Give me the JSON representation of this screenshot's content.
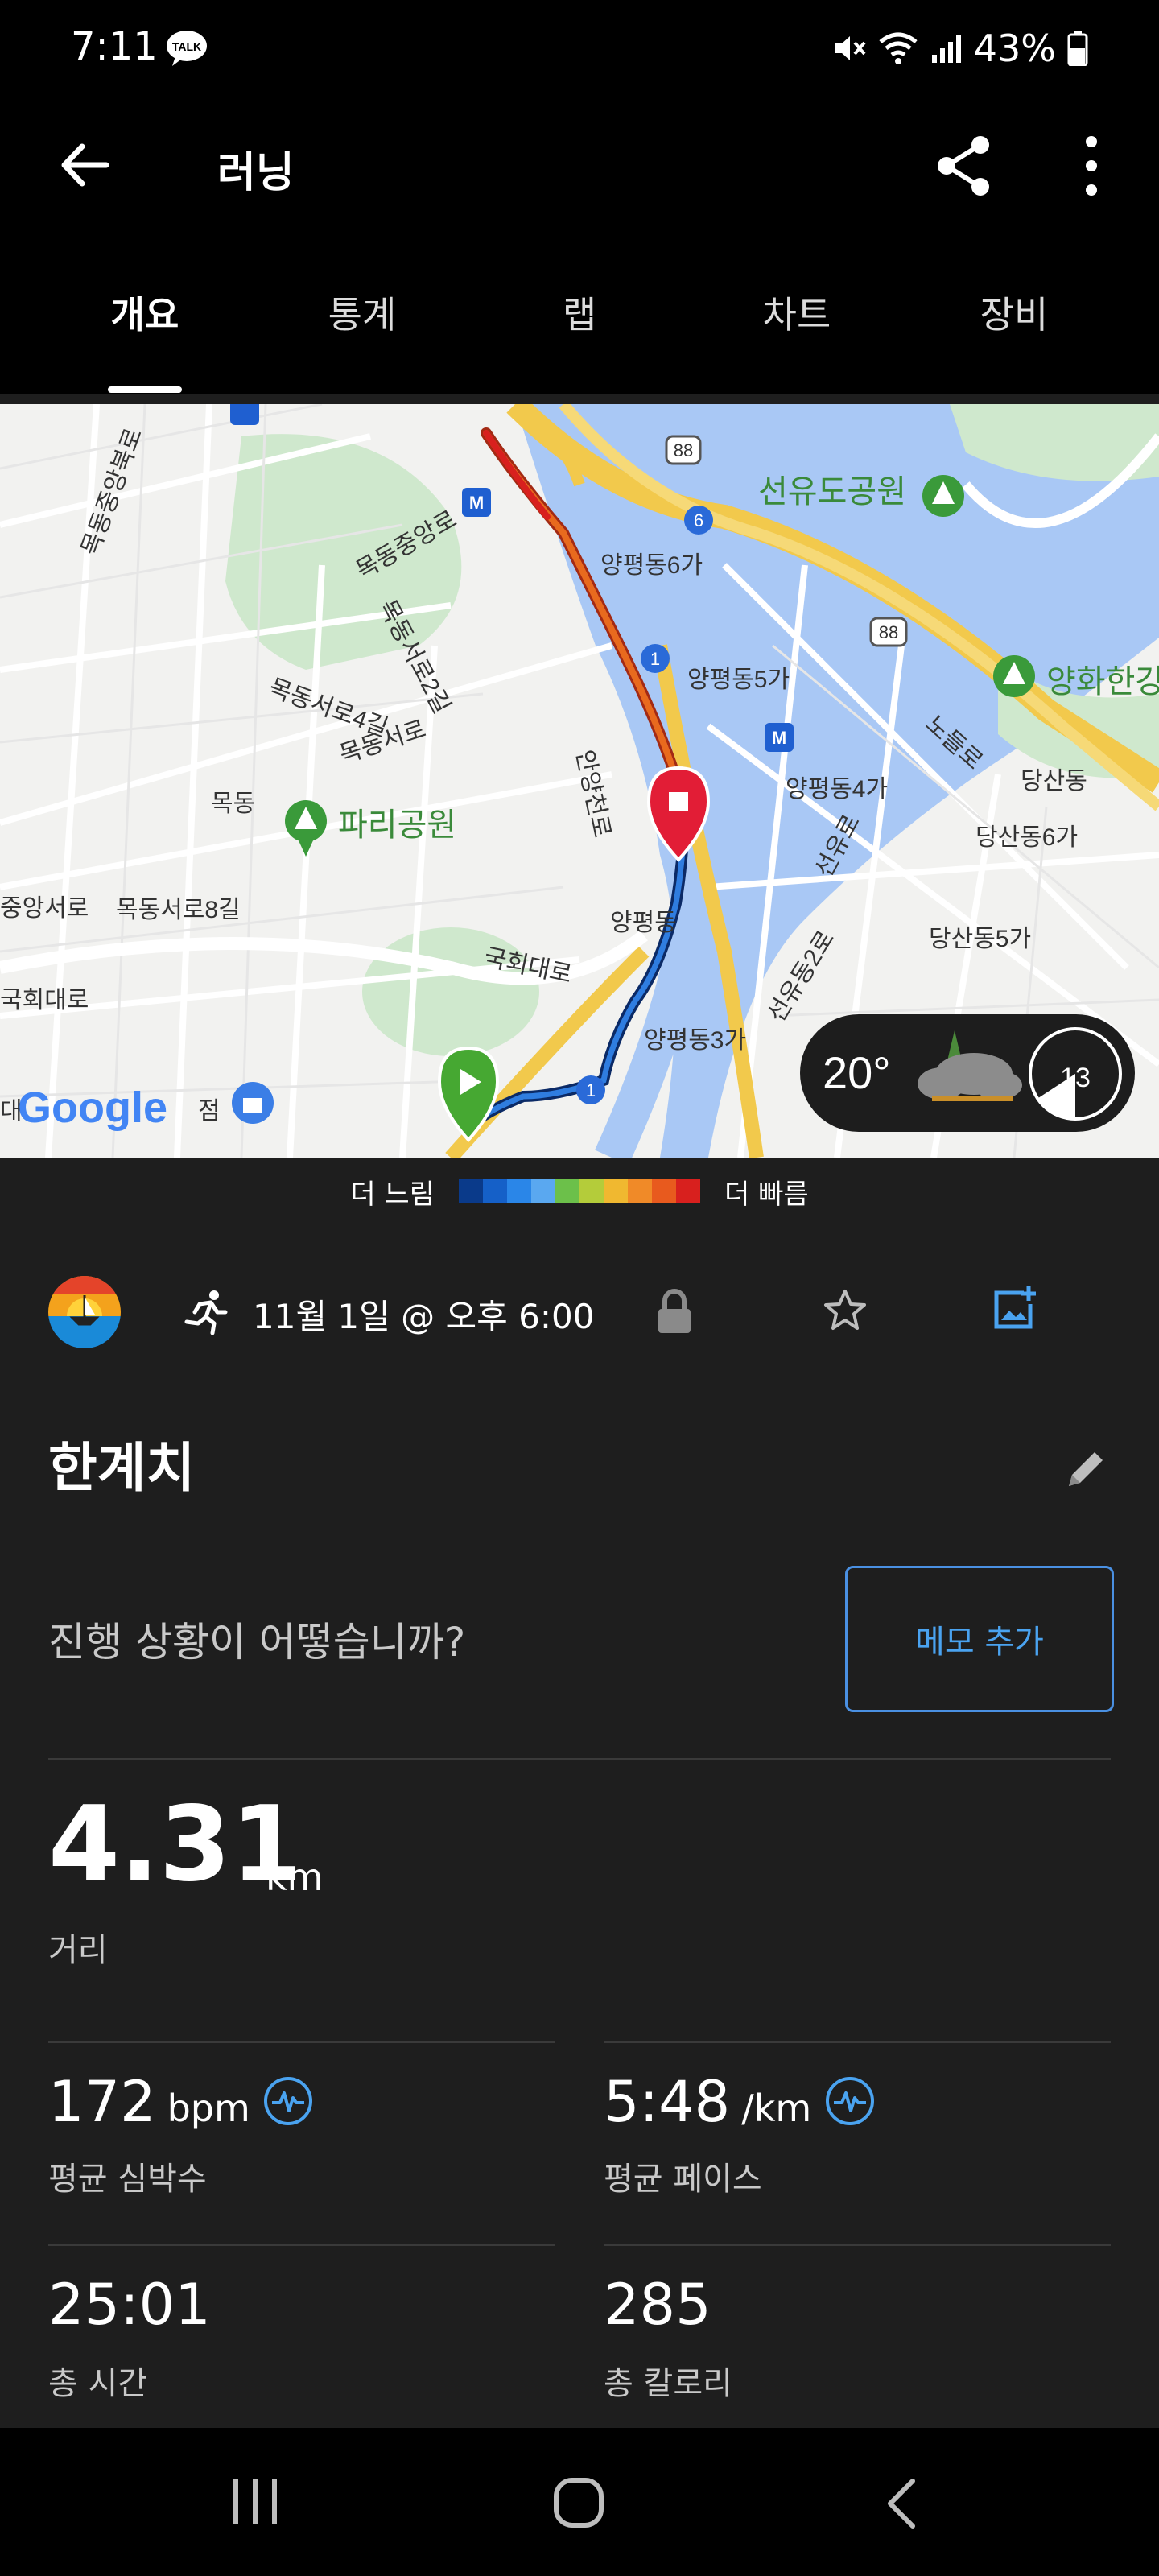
{
  "status_bar": {
    "time": "7:11",
    "talk_badge": "TALK",
    "battery_pct": "43%"
  },
  "header": {
    "title": "러닝"
  },
  "tabs": [
    {
      "label": "개요",
      "active": true
    },
    {
      "label": "통계"
    },
    {
      "label": "랩"
    },
    {
      "label": "차트"
    },
    {
      "label": "장비"
    }
  ],
  "map": {
    "labels": {
      "seonyudo_park": "선유도공원",
      "yanghwa": "양화한강",
      "paris_park": "파리공원",
      "yp6": "양평동6가",
      "yp5": "양평동5가",
      "yp4": "양평동4가",
      "yp3": "양평동3가",
      "yp": "양평동",
      "dangsan": "당산동",
      "dangsan6": "당산동6가",
      "dangsan5": "당산동5가",
      "mokdong": "목동",
      "mokdongseoro": "목동서로",
      "mokdongseoro4": "목동서로4길",
      "mokdongseoro2": "목동서로2길",
      "mokdongseoro8": "목동서로8길",
      "mokdongjungangro": "목동중앙로",
      "mokdongjungangbukro": "목동중앙북로",
      "jungangseoro": "중앙서로",
      "gukhoedaero": "국회대로",
      "gukhoedaero2": "국회대로",
      "anyangcheonro": "안양천로",
      "seonyuro": "선유로",
      "seonyudongro": "선유동2로",
      "nodeulro": "노들로",
      "route88a": "88",
      "route88b": "88",
      "route1a": "1",
      "route1b": "1",
      "route6": "6",
      "metro": "M",
      "google": "Google",
      "store": "점",
      "da": "대"
    },
    "weather": {
      "temperature": "20°",
      "moon": "13"
    }
  },
  "legend": {
    "slower": "더 느림",
    "faster": "더 빠름",
    "colors": [
      "#0a3a8a",
      "#1560c8",
      "#2a86e8",
      "#5aa8f0",
      "#6cc04a",
      "#b4cc3a",
      "#f0b830",
      "#f08a28",
      "#e85a1e",
      "#d8201e"
    ]
  },
  "activity": {
    "datetime": "11월 1일 @ 오후 6:00",
    "title": "한계치",
    "note_prompt": "진행 상황이 어떻습니까?",
    "memo_button": "메모 추가"
  },
  "stats": {
    "distance": {
      "value": "4.31",
      "unit": "km",
      "label": "거리"
    },
    "avg_hr": {
      "value": "172",
      "unit": "bpm",
      "label": "평균 심박수"
    },
    "avg_pace": {
      "value": "5:48",
      "unit": "/km",
      "label": "평균 페이스"
    },
    "total_time": {
      "value": "25:01",
      "label": "총 시간"
    },
    "calories": {
      "value": "285",
      "label": "총 칼로리"
    }
  },
  "colors": {
    "accent": "#4a90e2",
    "background": "#1e1e1e",
    "route_fast": "#d8201e",
    "route_slow": "#1b4fae"
  }
}
